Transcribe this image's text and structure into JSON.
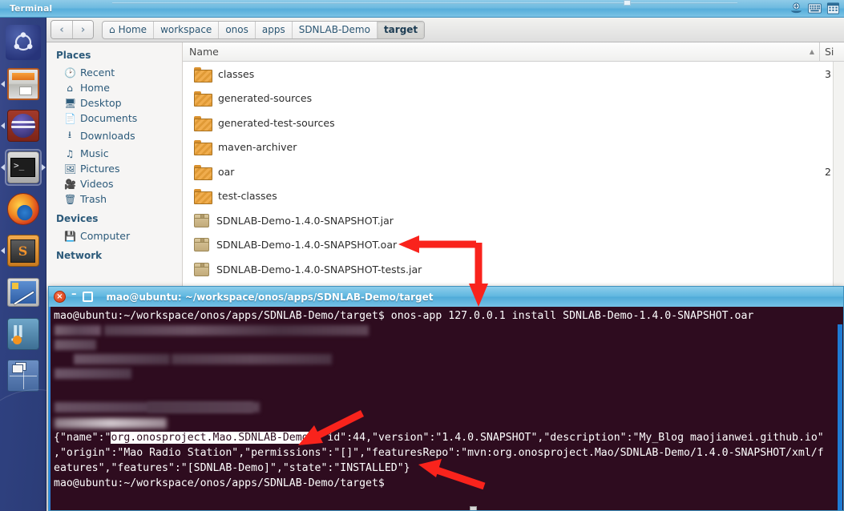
{
  "panel": {
    "title": "Terminal",
    "tray_icons": [
      "sync-icon",
      "keyboard-icon",
      "calendar-icon"
    ]
  },
  "dock": {
    "items": [
      {
        "name": "ubuntu-dash-icon",
        "label": "Ubuntu Dash"
      },
      {
        "name": "files-icon",
        "label": "Files"
      },
      {
        "name": "amarok-icon",
        "label": "Amarok"
      },
      {
        "name": "terminal-icon",
        "label": "Terminal"
      },
      {
        "name": "firefox-icon",
        "label": "Firefox"
      },
      {
        "name": "sublime-text-icon",
        "label": "Sublime Text"
      },
      {
        "name": "editor-icon",
        "label": "Editor"
      },
      {
        "name": "intellij-idea-icon",
        "label": "IntelliJ IDEA"
      },
      {
        "name": "workspace-switcher-icon",
        "label": "Workspace Switcher"
      }
    ]
  },
  "file_manager": {
    "nav": {
      "back": "‹",
      "forward": "›"
    },
    "breadcrumbs": [
      {
        "label": "Home",
        "icon": "home-icon",
        "current": false
      },
      {
        "label": "workspace",
        "current": false
      },
      {
        "label": "onos",
        "current": false
      },
      {
        "label": "apps",
        "current": false
      },
      {
        "label": "SDNLAB-Demo",
        "current": false
      },
      {
        "label": "target",
        "current": true
      }
    ],
    "sidebar": {
      "places_header": "Places",
      "places": [
        {
          "label": "Recent",
          "icon": "clock-icon"
        },
        {
          "label": "Home",
          "icon": "home-icon"
        },
        {
          "label": "Desktop",
          "icon": "monitor-icon"
        },
        {
          "label": "Documents",
          "icon": "document-icon"
        },
        {
          "label": "Downloads",
          "icon": "download-icon"
        },
        {
          "label": "Music",
          "icon": "music-note-icon"
        },
        {
          "label": "Pictures",
          "icon": "image-icon"
        },
        {
          "label": "Videos",
          "icon": "film-icon"
        },
        {
          "label": "Trash",
          "icon": "trash-icon"
        }
      ],
      "devices_header": "Devices",
      "devices": [
        {
          "label": "Computer",
          "icon": "computer-icon"
        }
      ],
      "network_header": "Network"
    },
    "columns": {
      "name": "Name",
      "size": "Si"
    },
    "rows": [
      {
        "name": "classes",
        "type": "folder",
        "size": "3"
      },
      {
        "name": "generated-sources",
        "type": "folder",
        "size": ""
      },
      {
        "name": "generated-test-sources",
        "type": "folder",
        "size": ""
      },
      {
        "name": "maven-archiver",
        "type": "folder",
        "size": ""
      },
      {
        "name": "oar",
        "type": "folder",
        "size": "2"
      },
      {
        "name": "test-classes",
        "type": "folder",
        "size": ""
      },
      {
        "name": "SDNLAB-Demo-1.4.0-SNAPSHOT.jar",
        "type": "archive",
        "size": ""
      },
      {
        "name": "SDNLAB-Demo-1.4.0-SNAPSHOT.oar",
        "type": "archive",
        "size": ""
      },
      {
        "name": "SDNLAB-Demo-1.4.0-SNAPSHOT-tests.jar",
        "type": "archive",
        "size": ""
      }
    ]
  },
  "terminal": {
    "title": "mao@ubuntu: ~/workspace/onos/apps/SDNLAB-Demo/target",
    "controls": {
      "close": "×",
      "minimize": "–",
      "maximize": "❑"
    },
    "prompt": "mao@ubuntu:~/workspace/onos/apps/SDNLAB-Demo/target$",
    "command": " onos-app 127.0.0.1 install SDNLAB-Demo-1.4.0-SNAPSHOT.oar",
    "output": {
      "selected_text": "org.onosproject.Mao.SDNLAB-Demo",
      "line1_prefix": "{\"name\":\"",
      "line1_suffix": "\",\"id\":44,\"version\":\"1.4.0.SNAPSHOT\",\"description\":\"My_Blog maojianwei.github.io\"",
      "line2": ",\"origin\":\"Mao Radio Station\",\"permissions\":\"[]\",\"featuresRepo\":\"mvn:org.onosproject.Mao/SDNLAB-Demo/1.4.0-SNAPSHOT/xml/f",
      "line3": "eatures\",\"features\":\"[SDNLAB-Demo]\",\"state\":\"INSTALLED\"}"
    },
    "final_prompt": "mao@ubuntu:~/workspace/onos/apps/SDNLAB-Demo/target$"
  },
  "annotations": {
    "arrow_color": "#f9231c",
    "arrows": [
      {
        "name": "arrow-to-oar-file",
        "target": "SDNLAB-Demo-1.4.0-SNAPSHOT.oar"
      },
      {
        "name": "arrow-to-install-command",
        "target": "install command"
      },
      {
        "name": "arrow-to-app-name",
        "target": "org.onosproject.Mao.SDNLAB-Demo"
      },
      {
        "name": "arrow-to-installed-state",
        "target": "INSTALLED"
      }
    ]
  },
  "colors": {
    "panel_blue": "#5eb6df",
    "terminal_bg": "#2e0c1f",
    "dock_blue": "#2f4180",
    "crumb_text": "#2b5673",
    "annotation_red": "#f9231c"
  }
}
